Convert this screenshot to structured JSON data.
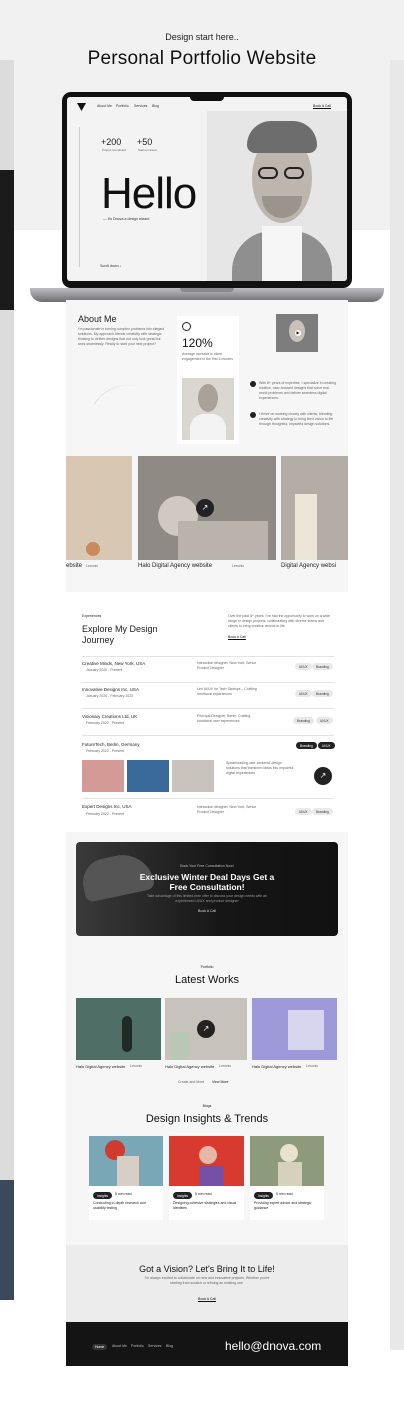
{
  "header": {
    "subtitle": "Design start here..",
    "title": "Personal Portfolio Website"
  },
  "hero": {
    "nav": [
      "About Me",
      "Portfolio",
      "Services",
      "Blog"
    ],
    "nav_cta": "Book A Call",
    "stats": [
      {
        "value": "+200",
        "label": "Project completed"
      },
      {
        "value": "+50",
        "label": "Startup raised"
      }
    ],
    "headline": "Hello",
    "tagline": "— It's Dnova a design wizard",
    "scroll": "Scroll down ↓"
  },
  "about": {
    "title": "About Me",
    "intro": "I'm passionate in turning complex problems into elegant solutions. My approach blends creativity with strategic thinking to deliver designs that not only look great but work seamlessly. Ready to start your next project?",
    "metric": "120%",
    "metric_desc": "Average increase in client engagement in the first 6 months",
    "points": [
      "With 8+ years of expertise, I specialize in creating intuitive, user-focused designs that solve real-world problems and deliver seamless digital experiences.",
      "I thrive on working closely with clients, blending creativity with strategy to bring their vision to life through thoughtful, impactful design solutions."
    ]
  },
  "carousel": {
    "items": [
      {
        "label": "ebsite",
        "tag": "Lexonic"
      },
      {
        "label": "Halo Digital Agency website",
        "tag": "Lexonic"
      },
      {
        "label": "Digital Agency websi"
      }
    ]
  },
  "experience": {
    "tag": "Experiences",
    "title": "Explore My Design Journey",
    "desc": "Over the past 8+ years, I've had the opportunity to work on a wide range of design projects, collaborating with diverse teams and clients to bring creative visions to life.",
    "link": "Book A Call",
    "jobs": [
      {
        "company": "Creative Minds, New York, USA",
        "date": "January 2020 - Present",
        "role": "Interaction designer, New York, Senior Product Designer",
        "tags": [
          "UI/UX",
          "Branding"
        ]
      },
      {
        "company": "Innovative Designs Inc, USA",
        "date": "January 2020 - February 2023",
        "role": "Led UI/UX for Tech Startups – Crafting functional experiences",
        "tags": [
          "UI/UX",
          "Branding"
        ]
      },
      {
        "company": "Visionary Creations Ltd, UK",
        "date": "February 2022 - Present",
        "role": "Principal Designer, Berlin, Crafting functional user experiences",
        "tags": [
          "Branding",
          "UI/UX"
        ]
      },
      {
        "company": "FutureTech, Berlin, Germany",
        "date": "February 2022 - Present",
        "role": "Spearheading user-centered design solutions that transform ideas into impactful digital experiences",
        "tags": [
          "Branding",
          "UI/UX"
        ]
      },
      {
        "company": "Expert Designs Inc, USA",
        "date": "February 2022 - Present",
        "role": "Interaction designer, New York, Senior Product Designer",
        "tags": [
          "UI/UX",
          "Branding"
        ]
      }
    ]
  },
  "promo": {
    "kicker": "Book Your Free Consultation Now!",
    "title": "Exclusive Winter Deal Days Get a Free Consultation!",
    "desc": "Take advantage of this limited-time offer to discuss your design needs with an experienced UI/UX and product designer",
    "button": "Book A Call"
  },
  "works": {
    "tag": "Portfolio",
    "title": "Latest Works",
    "items": [
      {
        "label": "Halo Digital Agency website",
        "tag": "Lexonic"
      },
      {
        "label": "Halo Digital Agency website",
        "tag": "Lexonic"
      },
      {
        "label": "Halo Digital Agency website",
        "tag": "Lexonic"
      }
    ],
    "more_text": "Create and More",
    "more_link": "View More"
  },
  "blog": {
    "tag": "Blogs",
    "title": "Design Insights & Trends",
    "posts": [
      {
        "badge": "Insights",
        "read": "5 min read",
        "title": "Conducting in-depth research and usability testing"
      },
      {
        "badge": "Insights",
        "read": "5 min read",
        "title": "Designing cohesive strategies and visual identities"
      },
      {
        "badge": "Insights",
        "read": "5 min read",
        "title": "Providing expert advice and strategic guidance"
      }
    ]
  },
  "cta": {
    "title": "Got a Vision? Let's Bring It to Life!",
    "desc": "I'm always excited to collaborate on new and innovative projects. Whether you're starting from scratch or refining an existing one.",
    "link": "Book A Call"
  },
  "footer": {
    "links": [
      "Home",
      "About Me",
      "Portfolio",
      "Services",
      "Blog"
    ],
    "email": "hello@dnova.com"
  },
  "colors": {
    "dark": "#141414",
    "background": "#f1f1f1",
    "accent": "#cf3b2f"
  }
}
